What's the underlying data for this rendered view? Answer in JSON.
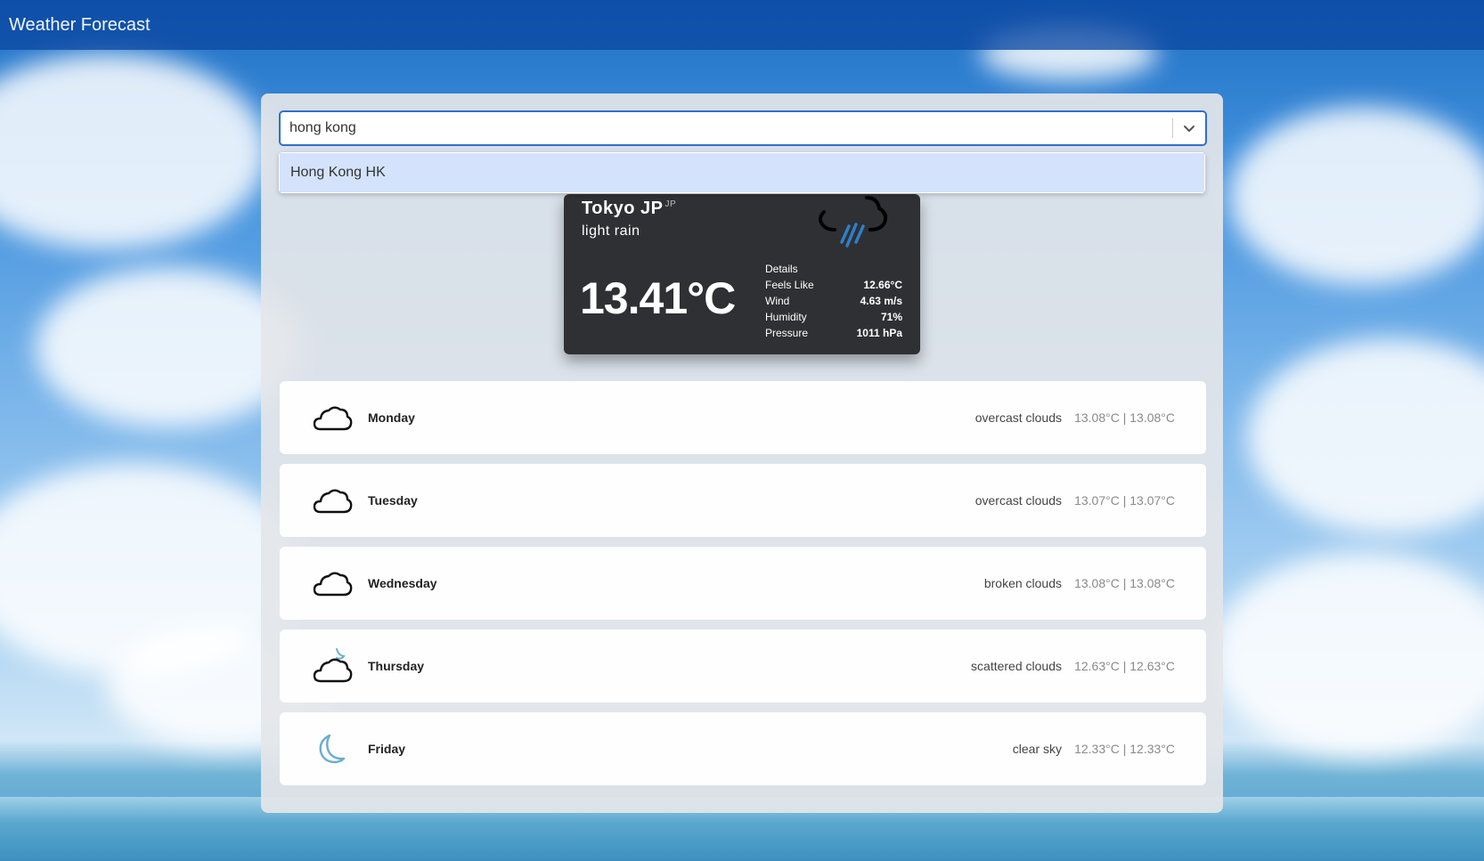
{
  "header": {
    "title": "Weather Forecast"
  },
  "search": {
    "value": "hong kong",
    "placeholder": ""
  },
  "suggestions": [
    {
      "label": "Hong Kong HK"
    }
  ],
  "current": {
    "city": "Tokyo JP",
    "country_sup": "JP",
    "condition": "light rain",
    "temperature": "13.41°C",
    "details_title": "Details",
    "details": [
      {
        "label": "Feels Like",
        "value": "12.66°C"
      },
      {
        "label": "Wind",
        "value": "4.63 m/s"
      },
      {
        "label": "Humidity",
        "value": "71%"
      },
      {
        "label": "Pressure",
        "value": "1011 hPa"
      }
    ],
    "icon": "rain-icon"
  },
  "forecast": [
    {
      "day": "Monday",
      "description": "overcast clouds",
      "temps": "13.08°C | 13.08°C",
      "icon": "cloud-icon"
    },
    {
      "day": "Tuesday",
      "description": "overcast clouds",
      "temps": "13.07°C | 13.07°C",
      "icon": "cloud-icon"
    },
    {
      "day": "Wednesday",
      "description": "broken clouds",
      "temps": "13.08°C | 13.08°C",
      "icon": "cloud-icon"
    },
    {
      "day": "Thursday",
      "description": "scattered clouds",
      "temps": "12.63°C | 12.63°C",
      "icon": "cloud-moon-icon"
    },
    {
      "day": "Friday",
      "description": "clear sky",
      "temps": "12.33°C | 12.33°C",
      "icon": "moon-icon"
    }
  ],
  "colors": {
    "accent": "#2f6fcf",
    "card": "#2e3033",
    "rain": "#2f7fc6",
    "moon": "#6aaed0"
  }
}
